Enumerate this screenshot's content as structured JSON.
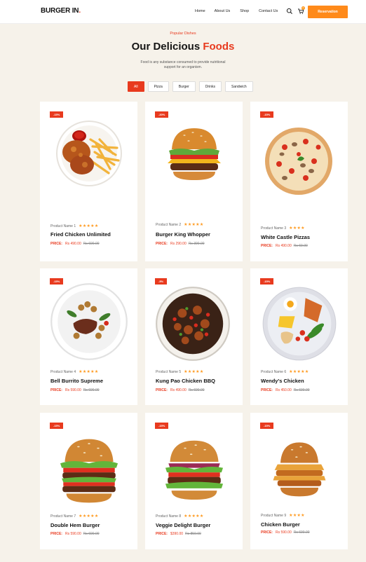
{
  "header": {
    "logo": "BURGER IN",
    "logo_dot": ".",
    "nav": [
      "Home",
      "About Us",
      "Shop",
      "Contact Us"
    ],
    "cart_count": "0",
    "reserve_label": "Reservation"
  },
  "section": {
    "subtitle": "Popular Dishes",
    "title_prefix": "Our Delicious ",
    "title_highlight": "Foods",
    "description": "Food is any substance consumed to provide nutritional support for an organism."
  },
  "filters": [
    "All",
    "Pizza",
    "Burger",
    "Drinks",
    "Sandwich"
  ],
  "price_label": "PRICE:",
  "products": [
    {
      "badge": "-15%",
      "product_no": "Product Name 1",
      "name": "Fried Chicken Unlimited",
      "price": "Rs 490.00",
      "old_price": "Rs 690.00",
      "rating": "★★★★★",
      "image": "fried-chicken"
    },
    {
      "badge": "-20%",
      "product_no": "Product Name 2",
      "name": "Burger King Whopper",
      "price": "Rs 290.00",
      "old_price": "Rs 390.00",
      "rating": "★★★★★",
      "image": "burger"
    },
    {
      "badge": "-15%",
      "product_no": "Product Name 3",
      "name": "White Castle Pizzas",
      "price": "Rs 490.00",
      "old_price": "Rs 69.00",
      "rating": "★★★★",
      "image": "pizza"
    },
    {
      "badge": "-15%",
      "product_no": "Product Name 4",
      "name": "Bell Burrito Supreme",
      "price": "Rs 590.00",
      "old_price": "Rs 690.00",
      "rating": "★★★★★",
      "image": "steak-plate"
    },
    {
      "badge": "-5%",
      "product_no": "Product Name 5",
      "name": "Kung Pao Chicken BBQ",
      "price": "Rs 490.00",
      "old_price": "Rs 690.00",
      "rating": "★★★★★",
      "image": "kung-pao"
    },
    {
      "badge": "-15%",
      "product_no": "Product Name 6",
      "name": "Wendy's Chicken",
      "price": "Rs 450.00",
      "old_price": "Rs 690.00",
      "rating": "★★★★★",
      "image": "platter"
    },
    {
      "badge": "-15%",
      "product_no": "Product Name 7",
      "name": "Double Hem Burger",
      "price": "Rs 590.00",
      "old_price": "Rs 690.00",
      "rating": "★★★★★",
      "image": "double-burger"
    },
    {
      "badge": "-15%",
      "product_no": "Product Name 8",
      "name": "Veggie Delight Burger",
      "price": "$390.00",
      "old_price": "Rs 859.00",
      "rating": "★★★★★",
      "image": "veggie-burger"
    },
    {
      "badge": "-15%",
      "product_no": "Product Name 9",
      "name": "Chicken Burger",
      "price": "Rs 590.00",
      "old_price": "Rs 690.00",
      "rating": "★★★★",
      "image": "chicken-burger"
    }
  ]
}
